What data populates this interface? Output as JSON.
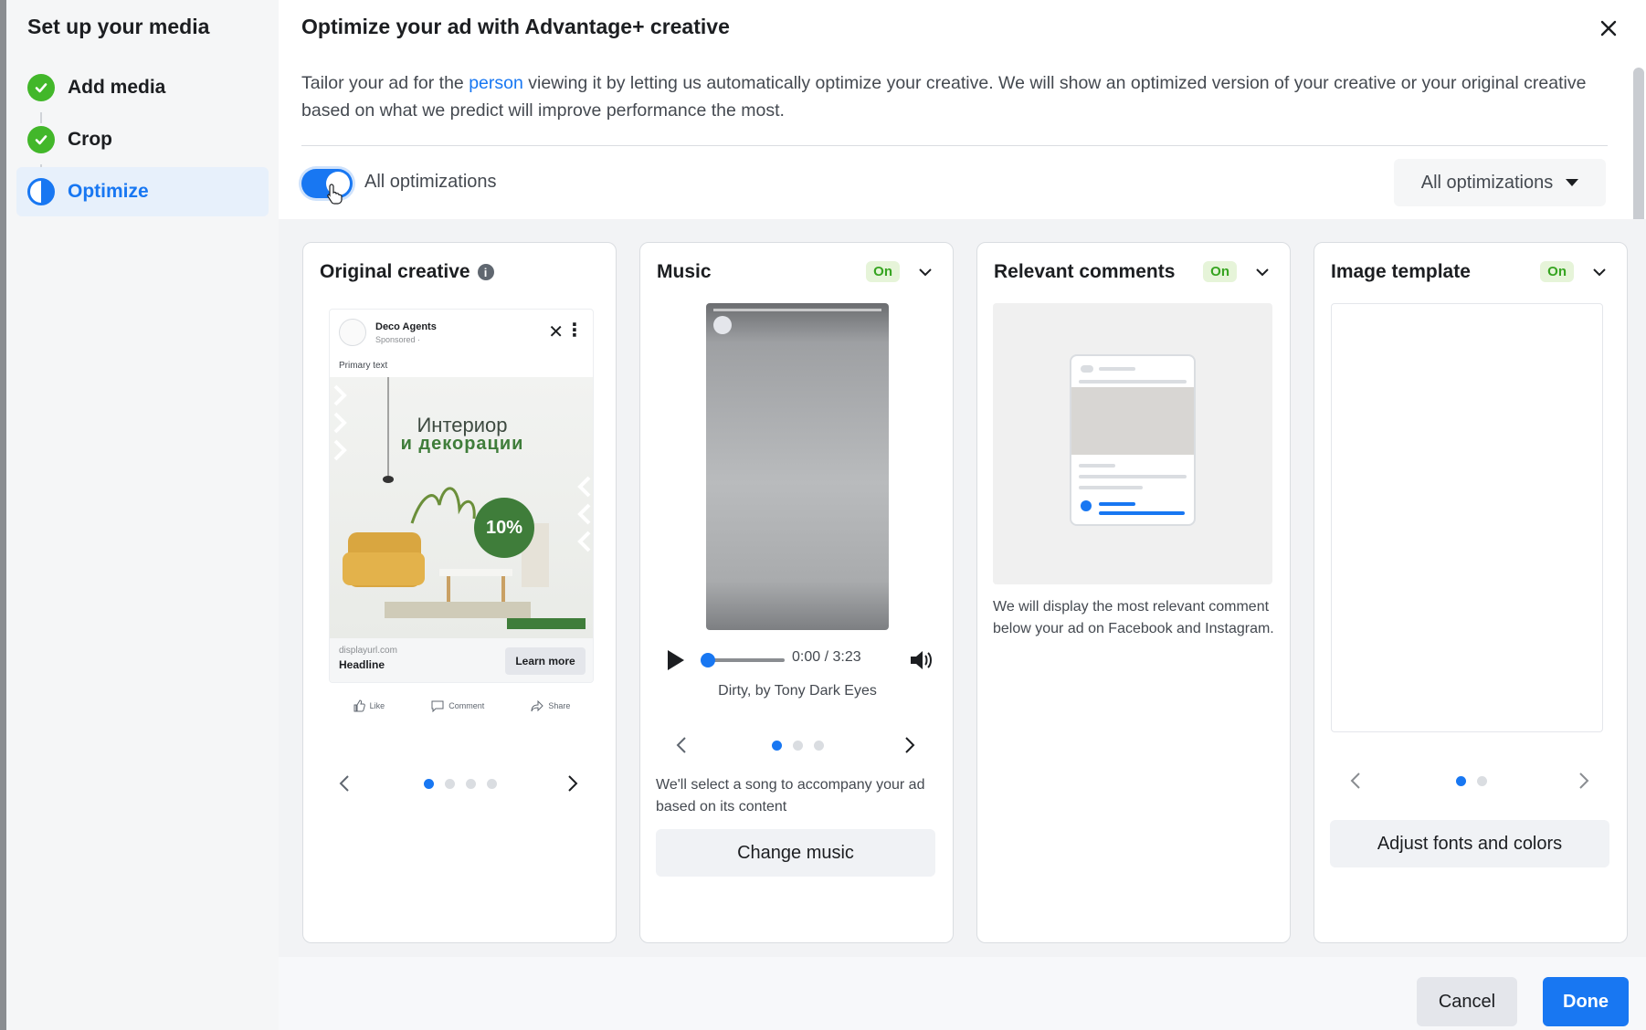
{
  "sidebar": {
    "title": "Set up your media",
    "steps": [
      {
        "label": "Add media"
      },
      {
        "label": "Crop"
      },
      {
        "label": "Optimize"
      }
    ]
  },
  "dialog": {
    "title": "Optimize your ad with Advantage+ creative",
    "description_before": "Tailor your ad for the ",
    "description_link": "person",
    "description_after": " viewing it by letting us automatically optimize your creative. We will show an optimized version of your creative or your original creative based on what we predict will improve performance the most.",
    "toggle_label": "All optimizations",
    "dropdown_value": "All optimizations"
  },
  "cards": {
    "original": {
      "title": "Original creative",
      "ad": {
        "brand": "Deco Agents",
        "sponsored": "Sponsored · ",
        "primary_text": "Primary text",
        "image_line1": "Интериор",
        "image_line2": "и декорации",
        "discount": "10%",
        "url": "displayurl.com",
        "headline": "Headline",
        "cta": "Learn more",
        "like": "Like",
        "comment": "Comment",
        "share": "Share"
      }
    },
    "music": {
      "title": "Music",
      "badge": "On",
      "time": "0:00 / 3:23",
      "song": "Dirty, by Tony Dark Eyes",
      "text": "We'll select a song to accompany your ad based on its content",
      "button": "Change music"
    },
    "comments": {
      "title": "Relevant comments",
      "badge": "On",
      "text": "We will display the most relevant comment below your ad on Facebook and Instagram."
    },
    "template": {
      "title": "Image template",
      "badge": "On",
      "button": "Adjust fonts and colors"
    }
  },
  "footer": {
    "cancel": "Cancel",
    "done": "Done"
  },
  "colors": {
    "accent": "#1877f2",
    "success": "#42b72a",
    "badge_bg": "#e6f4d9"
  }
}
